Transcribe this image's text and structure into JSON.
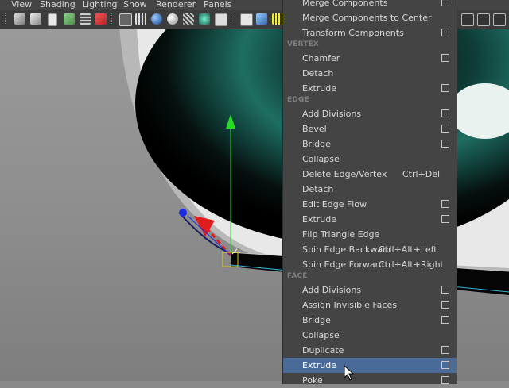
{
  "menubar": {
    "items": [
      "View",
      "Shading",
      "Lighting",
      "Show",
      "Renderer",
      "Panels"
    ]
  },
  "toolbar": {
    "icons": [
      "camera-icon",
      "camera-attrs-icon",
      "bookmark-icon",
      "image-plane-icon",
      "grid-icon",
      "resolution-gate-icon",
      "wireframe-icon",
      "smooth-shade-icon",
      "shaded-sphere-icon",
      "flat-shade-icon",
      "xray-icon",
      "lights-icon",
      "texture-icon",
      "cube-icon",
      "cube-shaded-icon",
      "grid-toggle-icon",
      "isolate-icon",
      "panel-layout-icon"
    ]
  },
  "context_menu": {
    "top_items": [
      {
        "label": "Merge Components",
        "option_box": true
      },
      {
        "label": "Merge Components to Center",
        "option_box": false
      },
      {
        "label": "Transform Components",
        "option_box": true
      }
    ],
    "vertex_header": "VERTEX",
    "vertex_items": [
      {
        "label": "Chamfer",
        "option_box": true
      },
      {
        "label": "Detach",
        "option_box": false
      },
      {
        "label": "Extrude",
        "option_box": true
      }
    ],
    "edge_header": "EDGE",
    "edge_items": [
      {
        "label": "Add Divisions",
        "shortcut": "",
        "option_box": true
      },
      {
        "label": "Bevel",
        "shortcut": "",
        "option_box": true
      },
      {
        "label": "Bridge",
        "shortcut": "",
        "option_box": true
      },
      {
        "label": "Collapse",
        "shortcut": "",
        "option_box": false
      },
      {
        "label": "Delete Edge/Vertex",
        "shortcut": "Ctrl+Del",
        "option_box": false
      },
      {
        "label": "Detach",
        "shortcut": "",
        "option_box": false
      },
      {
        "label": "Edit Edge Flow",
        "shortcut": "",
        "option_box": true
      },
      {
        "label": "Extrude",
        "shortcut": "",
        "option_box": true
      },
      {
        "label": "Flip Triangle Edge",
        "shortcut": "",
        "option_box": false
      },
      {
        "label": "Spin Edge Backward",
        "shortcut": "Ctrl+Alt+Left",
        "option_box": false
      },
      {
        "label": "Spin Edge Forward",
        "shortcut": "Ctrl+Alt+Right",
        "option_box": false
      }
    ],
    "face_header": "FACE",
    "face_items": [
      {
        "label": "Add Divisions",
        "option_box": true
      },
      {
        "label": "Assign Invisible Faces",
        "option_box": true
      },
      {
        "label": "Bridge",
        "option_box": true
      },
      {
        "label": "Collapse",
        "option_box": false
      },
      {
        "label": "Duplicate",
        "option_box": true
      },
      {
        "label": "Extrude",
        "option_box": true,
        "highlighted": true
      },
      {
        "label": "Poke",
        "option_box": true
      }
    ]
  },
  "colors": {
    "menu_bg": "#444444",
    "menu_highlight": "#4a6b97",
    "section_header": "#7f7f7f",
    "manip_x": "#e01c1c",
    "manip_y": "#22dd22",
    "manip_z": "#1c2ce0",
    "selection": "#e0d020"
  }
}
